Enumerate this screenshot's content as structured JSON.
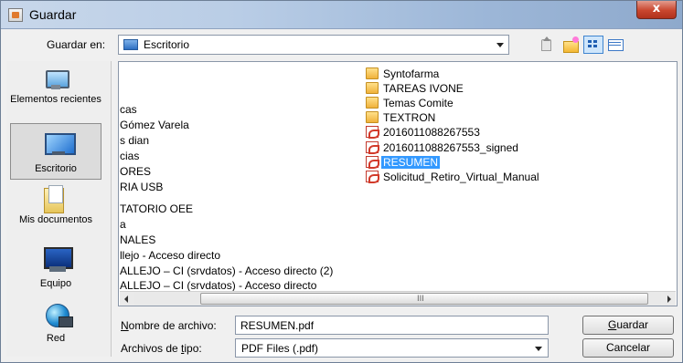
{
  "window": {
    "title": "Guardar",
    "close_label": "x"
  },
  "toolbar": {
    "save_in_label": "Guardar en:",
    "location": "Escritorio",
    "icons": [
      "up-one-level-icon",
      "new-folder-icon",
      "list-view-icon",
      "details-view-icon"
    ]
  },
  "places": [
    {
      "label": "Elementos recientes",
      "icon": "recent-items-icon"
    },
    {
      "label": "Escritorio",
      "icon": "desktop-icon",
      "selected": true
    },
    {
      "label": "Mis documentos",
      "icon": "documents-icon"
    },
    {
      "label": "Equipo",
      "icon": "computer-icon"
    },
    {
      "label": "Red",
      "icon": "network-icon"
    }
  ],
  "file_list": {
    "column1": [
      "cas",
      "Gómez Varela",
      "s dian",
      "cias",
      "ORES",
      "RIA USB",
      "",
      "TATORIO OEE",
      "a",
      "NALES",
      "llejo - Acceso directo",
      "ALLEJO – CI (srvdatos) - Acceso directo (2)",
      "ALLEJO – CI (srvdatos) - Acceso directo"
    ],
    "column2": [
      {
        "name": "Syntofarma",
        "type": "folder"
      },
      {
        "name": "TAREAS IVONE",
        "type": "folder"
      },
      {
        "name": "Temas Comite",
        "type": "folder"
      },
      {
        "name": "TEXTRON",
        "type": "folder"
      },
      {
        "name": "2016011088267553",
        "type": "pdf"
      },
      {
        "name": "2016011088267553_signed",
        "type": "pdf"
      },
      {
        "name": "RESUMEN",
        "type": "pdf",
        "selected": true
      },
      {
        "name": "Solicitud_Retiro_Virtual_Manual",
        "type": "pdf"
      }
    ],
    "scrollbar_grip": "III"
  },
  "form": {
    "filename_label_u": "N",
    "filename_label_rest": "ombre de archivo:",
    "filename_value": "RESUMEN.pdf",
    "filetype_label_pre": "Archivos de ",
    "filetype_label_u": "t",
    "filetype_label_rest": "ipo:",
    "filetype_value": "PDF Files (.pdf)",
    "save_u": "G",
    "save_rest": "uardar",
    "cancel_label": "Cancelar"
  },
  "colors": {
    "selection": "#3399ff",
    "titlebar": "#b9cde6",
    "close_button": "#c9462e"
  }
}
